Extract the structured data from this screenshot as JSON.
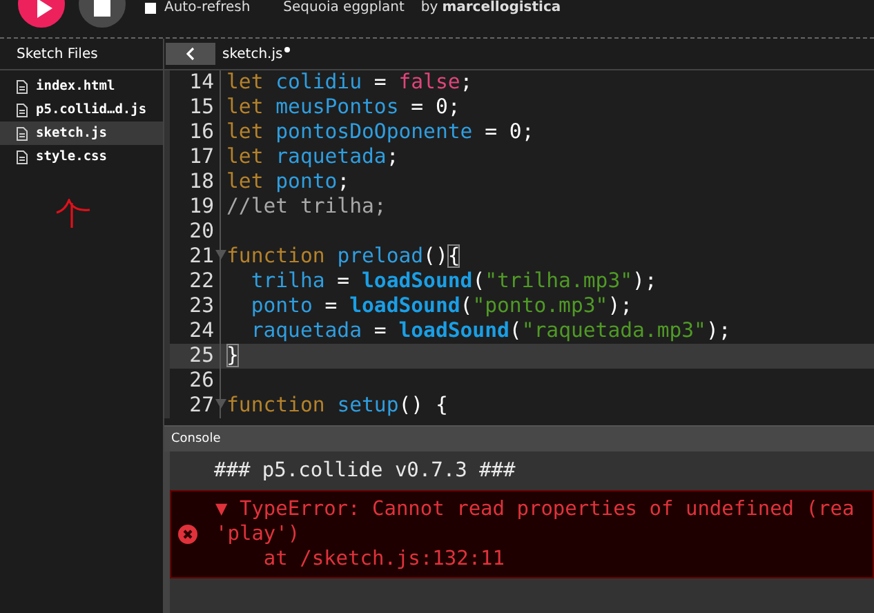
{
  "toolbar": {
    "auto_refresh": {
      "label": "Auto-refresh",
      "checked": false
    },
    "sketch_name": "Sequoia eggplant",
    "author_prefix": "by",
    "author": "marcellogistica"
  },
  "sidebar": {
    "title": "Sketch Files",
    "files": [
      {
        "name": "index.html",
        "selected": false
      },
      {
        "name": "p5.collid…d.js",
        "selected": false
      },
      {
        "name": "sketch.js",
        "selected": true
      },
      {
        "name": "style.css",
        "selected": false
      }
    ]
  },
  "editor": {
    "tab": {
      "label": "sketch.js",
      "unsaved": true
    },
    "lines": [
      {
        "number": "14",
        "fold": false,
        "active": false,
        "indent": false,
        "tokens": [
          {
            "kind": "kw",
            "text": "let "
          },
          {
            "kind": "var",
            "text": "colidiu"
          },
          {
            "kind": "op",
            "text": " = "
          },
          {
            "kind": "bool",
            "text": "false"
          },
          {
            "kind": "op",
            "text": ";"
          }
        ]
      },
      {
        "number": "15",
        "fold": false,
        "active": false,
        "indent": false,
        "tokens": [
          {
            "kind": "kw",
            "text": "let "
          },
          {
            "kind": "var",
            "text": "meusPontos"
          },
          {
            "kind": "op",
            "text": " = 0;"
          }
        ]
      },
      {
        "number": "16",
        "fold": false,
        "active": false,
        "indent": false,
        "tokens": [
          {
            "kind": "kw",
            "text": "let "
          },
          {
            "kind": "var",
            "text": "pontosDoOponente"
          },
          {
            "kind": "op",
            "text": " = 0;"
          }
        ]
      },
      {
        "number": "17",
        "fold": false,
        "active": false,
        "indent": false,
        "tokens": [
          {
            "kind": "kw",
            "text": "let "
          },
          {
            "kind": "var",
            "text": "raquetada"
          },
          {
            "kind": "op",
            "text": ";"
          }
        ]
      },
      {
        "number": "18",
        "fold": false,
        "active": false,
        "indent": false,
        "tokens": [
          {
            "kind": "kw",
            "text": "let "
          },
          {
            "kind": "var",
            "text": "ponto"
          },
          {
            "kind": "op",
            "text": ";"
          }
        ]
      },
      {
        "number": "19",
        "fold": false,
        "active": false,
        "indent": false,
        "tokens": [
          {
            "kind": "comment",
            "text": "//let trilha;"
          }
        ]
      },
      {
        "number": "20",
        "fold": false,
        "active": false
      },
      {
        "number": "21",
        "fold": true,
        "active": false,
        "indent": false,
        "tokens": [
          {
            "kind": "kw",
            "text": "function "
          },
          {
            "kind": "var",
            "text": "preload"
          },
          {
            "kind": "op",
            "text": "()"
          },
          {
            "kind": "match",
            "text": "{"
          }
        ]
      },
      {
        "number": "22",
        "fold": false,
        "active": false,
        "indent": true,
        "tokens": [
          {
            "kind": "var",
            "text": "trilha"
          },
          {
            "kind": "op",
            "text": " = "
          },
          {
            "kind": "fn",
            "text": "loadSound"
          },
          {
            "kind": "op",
            "text": "("
          },
          {
            "kind": "str",
            "text": "\"trilha.mp3\""
          },
          {
            "kind": "op",
            "text": ");"
          }
        ]
      },
      {
        "number": "23",
        "fold": false,
        "active": false,
        "indent": true,
        "tokens": [
          {
            "kind": "var",
            "text": "ponto"
          },
          {
            "kind": "op",
            "text": " = "
          },
          {
            "kind": "fn",
            "text": "loadSound"
          },
          {
            "kind": "op",
            "text": "("
          },
          {
            "kind": "str",
            "text": "\"ponto.mp3\""
          },
          {
            "kind": "op",
            "text": ");"
          }
        ]
      },
      {
        "number": "24",
        "fold": false,
        "active": false,
        "indent": true,
        "tokens": [
          {
            "kind": "var",
            "text": "raquetada"
          },
          {
            "kind": "op",
            "text": " = "
          },
          {
            "kind": "fn",
            "text": "loadSound"
          },
          {
            "kind": "op",
            "text": "("
          },
          {
            "kind": "str",
            "text": "\"raquetada.mp3\""
          },
          {
            "kind": "op",
            "text": ");"
          }
        ]
      },
      {
        "number": "25",
        "fold": false,
        "active": true,
        "indent": false,
        "tokens": [
          {
            "kind": "match",
            "text": "}"
          }
        ]
      },
      {
        "number": "26",
        "fold": false,
        "active": false
      },
      {
        "number": "27",
        "fold": true,
        "active": false,
        "indent": false,
        "tokens": [
          {
            "kind": "kw",
            "text": "function "
          },
          {
            "kind": "var",
            "text": "setup"
          },
          {
            "kind": "op",
            "text": "() {"
          }
        ]
      }
    ]
  },
  "console": {
    "title": "Console",
    "messages": [
      {
        "kind": "log",
        "lines": [
          "### p5.collide v0.7.3 ###"
        ]
      },
      {
        "kind": "error",
        "lines": [
          "▼ TypeError: Cannot read properties of undefined (rea",
          "'play')",
          "    at /sketch.js:132:11"
        ]
      }
    ]
  }
}
